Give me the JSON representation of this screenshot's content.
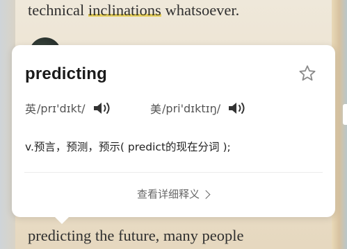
{
  "book": {
    "line_top_pre": "technical ",
    "line_top_highlight": "inclinations",
    "line_top_post": " whatsoever.",
    "line_bottom": "predicting the future, many people"
  },
  "popup": {
    "word": "predicting",
    "pronunciations": [
      {
        "label": "英",
        "ipa": "/prɪ'dɪkt/",
        "icon": "speaker-icon"
      },
      {
        "label": "美",
        "ipa": "/pri'dɪktɪŋ/",
        "icon": "speaker-icon"
      }
    ],
    "definition": "v.预言，预测，预示( predict的现在分词 );",
    "more_label": "查看详细释义",
    "favorite_icon": "star-outline-icon"
  },
  "colors": {
    "highlight": "#e6cf5a",
    "card": "#ffffff",
    "page": "#efe8da"
  }
}
